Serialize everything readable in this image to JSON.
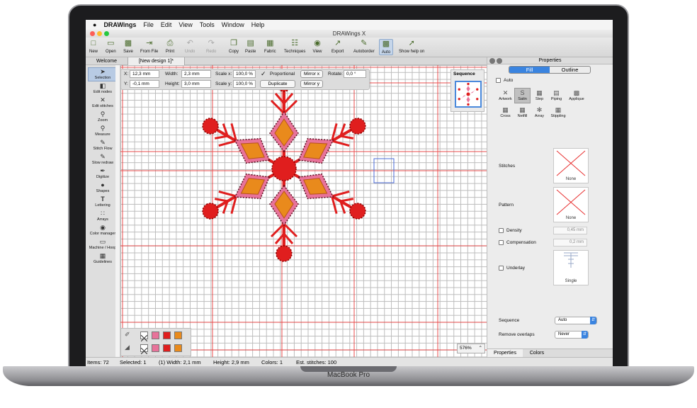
{
  "device": {
    "brand": "MacBook Pro"
  },
  "menubar": {
    "app": "DRAWings",
    "items": [
      "File",
      "Edit",
      "View",
      "Tools",
      "Window",
      "Help"
    ]
  },
  "window": {
    "title": "DRAWings X",
    "accent": "#3a84e0"
  },
  "toolbar": {
    "new": "New",
    "open": "Open",
    "save": "Save",
    "from_file": "From File",
    "print": "Print",
    "undo": "Undo",
    "redo": "Redo",
    "copy": "Copy",
    "paste": "Paste",
    "fabric": "Fabric",
    "techniques": "Techniques",
    "view": "View",
    "export": "Export",
    "autoborder": "Autoborder",
    "auto": "Auto",
    "show_help": "Show help on"
  },
  "tabs": {
    "welcome": "Welcome",
    "design": "[New design 1]*"
  },
  "tools": {
    "selection": "Selection",
    "edit_nodes": "Edit nodes",
    "edit_stitches": "Edit stitches",
    "zoom": "Zoom",
    "measure": "Measure",
    "stitch_flow": "Stitch Flow",
    "slow_redraw": "Slow redraw",
    "digitize": "Digitize",
    "shapes": "Shapes",
    "lettering": "Lettering",
    "arrays": "Arrays",
    "color_manager": "Color manager",
    "machine_hoop": "Machine / Hoop",
    "guidelines": "Guidelines"
  },
  "object_props": {
    "x_label": "X:",
    "x": "12,3 mm",
    "y_label": "Y:",
    "y": "-0,1 mm",
    "width_label": "Width:",
    "width": "2,3 mm",
    "height_label": "Height:",
    "height": "3,0 mm",
    "scalex_label": "Scale x:",
    "scalex": "100,0 %",
    "scaley_label": "Scale y:",
    "scaley": "100,0 %",
    "proportional": "Proportional",
    "mirror_x": "Mirror x",
    "duplicate": "Duplicate",
    "mirror_y": "Mirror y",
    "rotate_label": "Rotate:",
    "rotate": "0,0 °"
  },
  "sequence": {
    "label": "Sequence"
  },
  "zoom": {
    "value": "576%"
  },
  "palette": {
    "colors": [
      "#e8739a",
      "#e01e1e",
      "#e98a1c"
    ]
  },
  "properties": {
    "title": "Properties",
    "fill": "Fill",
    "outline": "Outline",
    "auto": "Auto",
    "types": [
      "Artwork",
      "Satin",
      "Step",
      "Piping",
      "Applique",
      "Cross",
      "Netfill",
      "Array",
      "Stippling"
    ],
    "stitches_label": "Stitches",
    "stitches_value": "None",
    "pattern_label": "Pattern",
    "pattern_value": "None",
    "density_label": "Density",
    "density_value": "0,45 mm",
    "compensation_label": "Compensation",
    "compensation_value": "0,2 mm",
    "underlay_label": "Underlay",
    "underlay_value": "Single",
    "sequence_label": "Sequence",
    "sequence_value": "Auto",
    "remove_overlaps_label": "Remove overlaps",
    "remove_overlaps_value": "Never",
    "tab_properties": "Properties",
    "tab_colors": "Colors"
  },
  "status": {
    "items": "Items: 72",
    "selected": "Selected: 1",
    "width": "(1) Width: 2,1 mm",
    "height": "Height: 2,9 mm",
    "colors": "Colors: 1",
    "est_stitches": "Est. stitches: 100"
  },
  "design_colors": {
    "pink": "#e8739a",
    "red": "#e01e1e",
    "orange": "#e98a1c",
    "guide": "#e83030"
  }
}
